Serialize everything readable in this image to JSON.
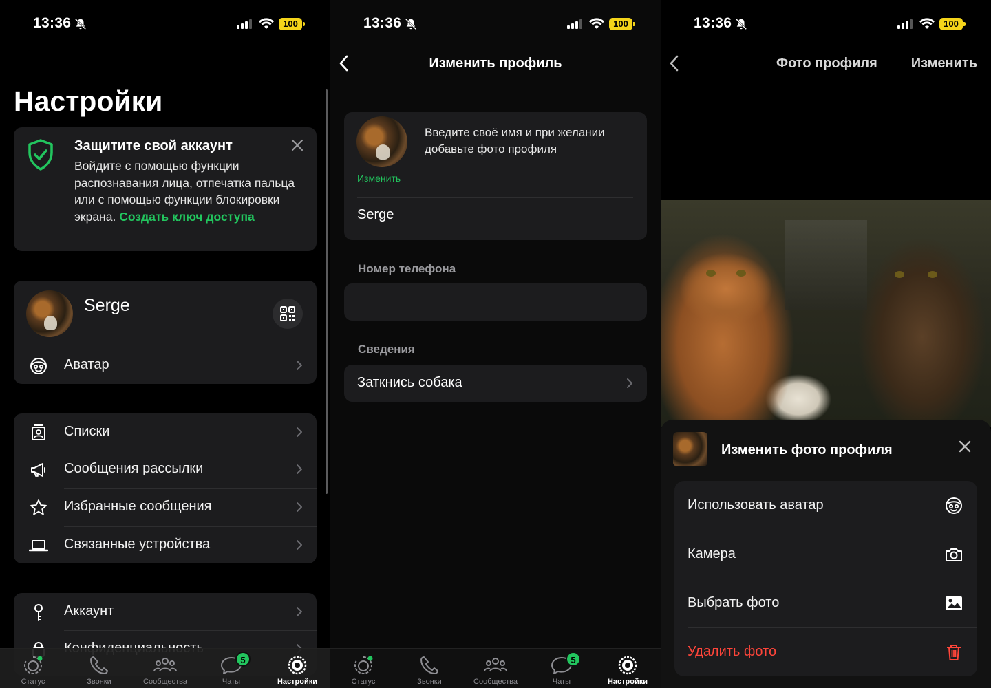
{
  "status_bar": {
    "time": "13:36",
    "battery": "100"
  },
  "settings": {
    "title": "Настройки",
    "protect": {
      "title": "Защитите свой аккаунт",
      "text": "Войдите с помощью функции распознавания лица, отпечатка пальца или с помощью функции блокировки экрана.",
      "link": "Создать ключ доступа"
    },
    "profile": {
      "name": "Serge",
      "avatar_row": "Аватар"
    },
    "lists": [
      {
        "label": "Списки",
        "icon": "contacts-list-icon"
      },
      {
        "label": "Сообщения рассылки",
        "icon": "megaphone-icon"
      },
      {
        "label": "Избранные сообщения",
        "icon": "star-icon"
      },
      {
        "label": "Связанные устройства",
        "icon": "laptop-icon"
      }
    ],
    "account": [
      {
        "label": "Аккаунт",
        "icon": "key-icon"
      },
      {
        "label": "Конфиденциальность",
        "icon": "lock-icon"
      }
    ]
  },
  "tabs": [
    {
      "label": "Статус",
      "icon": "status-icon"
    },
    {
      "label": "Звонки",
      "icon": "phone-icon"
    },
    {
      "label": "Сообщества",
      "icon": "communities-icon"
    },
    {
      "label": "Чаты",
      "icon": "chats-icon",
      "badge": "5"
    },
    {
      "label": "Настройки",
      "icon": "settings-gear-icon",
      "active": true
    }
  ],
  "edit_profile": {
    "title": "Изменить профиль",
    "edit_link": "Изменить",
    "hint": "Введите своё имя и при желании добавьте фото профиля",
    "name": "Serge",
    "phone_label": "Номер телефона",
    "phone_value": "",
    "about_label": "Сведения",
    "about_value": "Заткнись собака"
  },
  "profile_photo": {
    "title": "Фото профиля",
    "edit": "Изменить",
    "sheet": {
      "title": "Изменить фото профиля",
      "options": [
        {
          "label": "Использовать аватар",
          "icon": "avatar-face-icon"
        },
        {
          "label": "Камера",
          "icon": "camera-icon"
        },
        {
          "label": "Выбрать фото",
          "icon": "photo-icon"
        },
        {
          "label": "Удалить фото",
          "icon": "trash-icon",
          "danger": true
        }
      ]
    }
  },
  "colors": {
    "accent": "#22c55e",
    "danger": "#ff453a",
    "battery": "#f4d41a",
    "card": "#1c1c1e"
  }
}
